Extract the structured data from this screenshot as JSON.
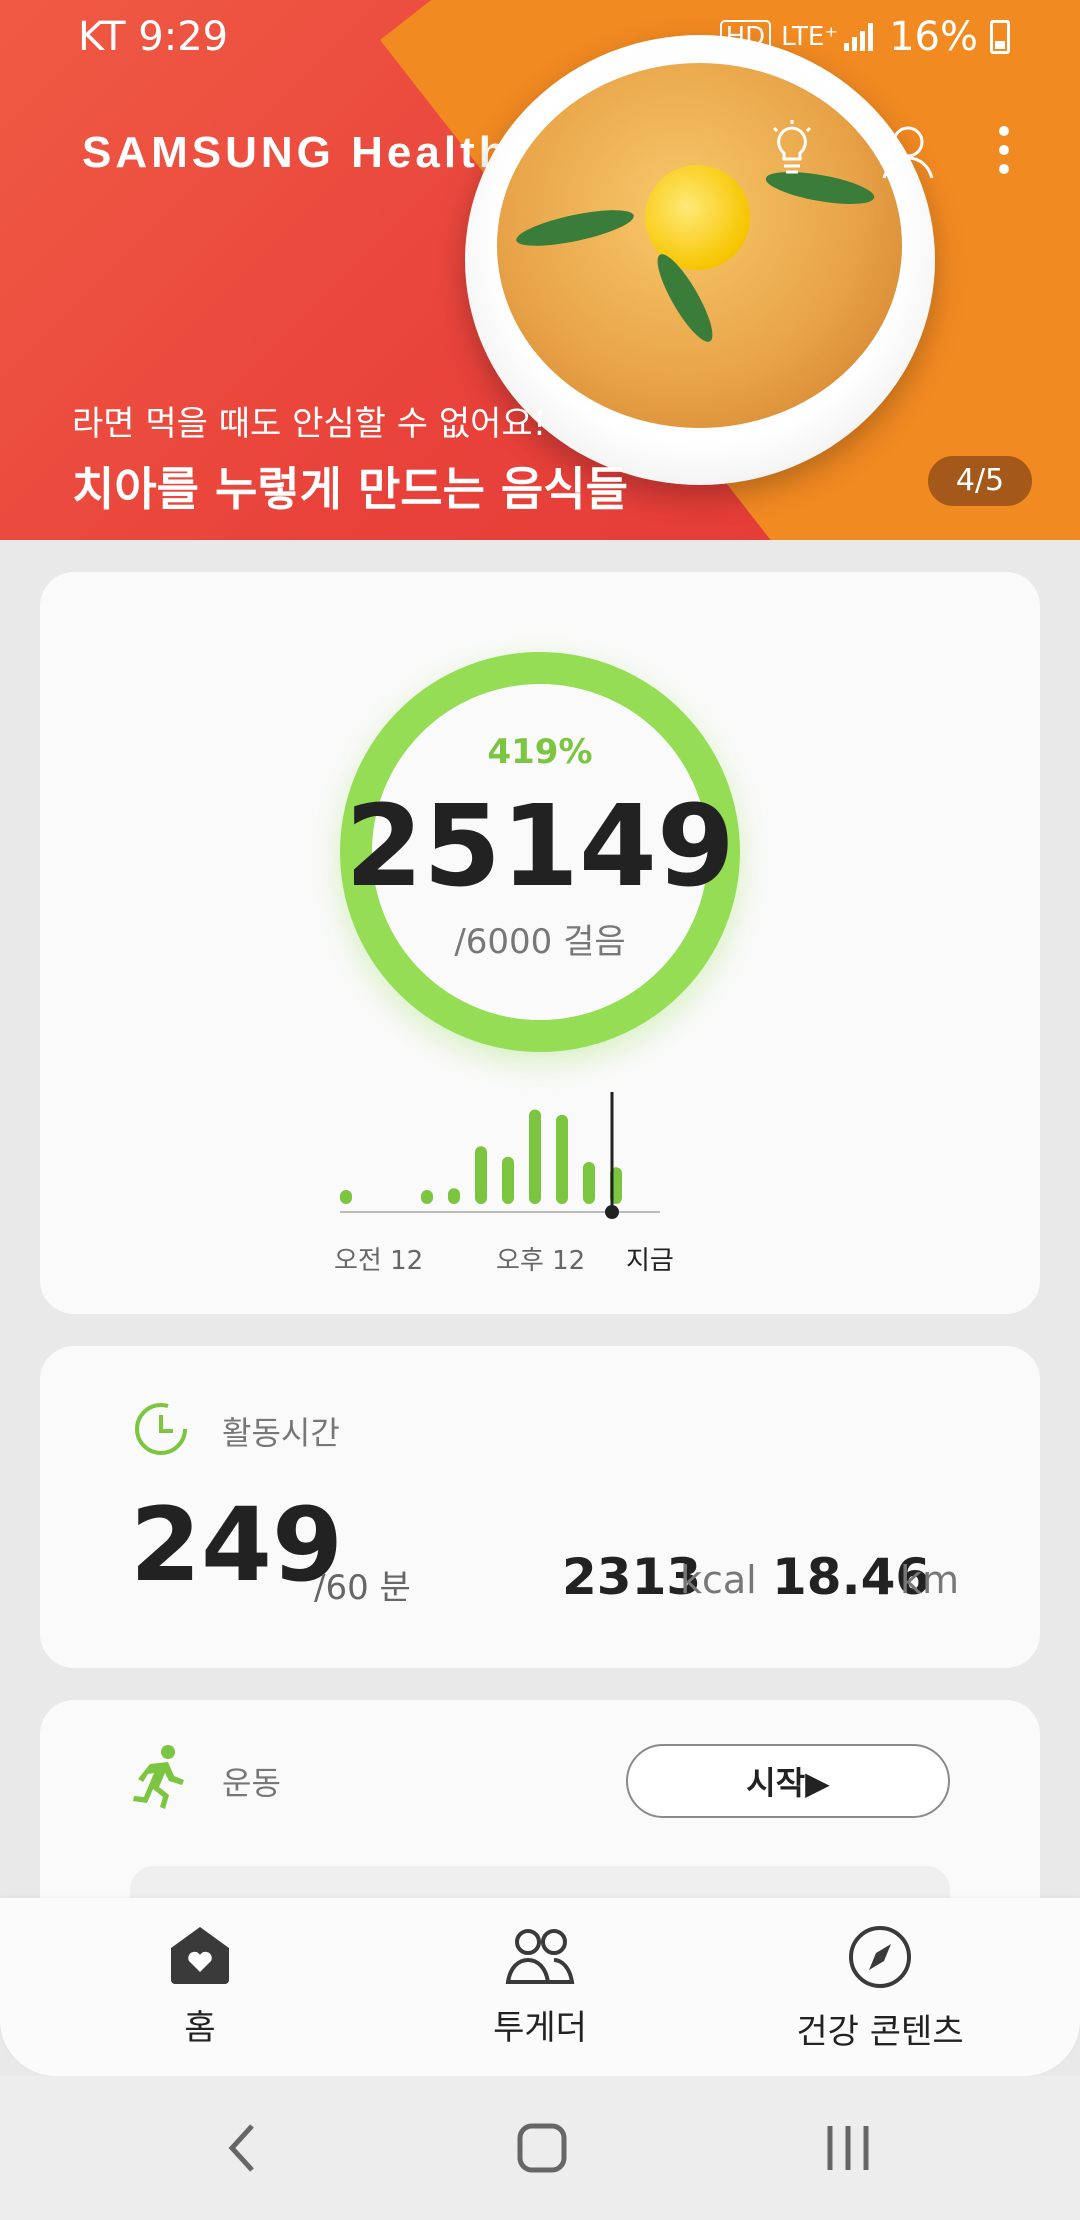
{
  "status_bar": {
    "carrier_time": "KT 9:29",
    "signal_badge": "HD",
    "network": "LTE⁺",
    "battery": "16%"
  },
  "header": {
    "logo": "SAMSUNG Health",
    "icons": [
      "lightbulb-icon",
      "profile-icon",
      "more-options-icon"
    ],
    "banner_subtitle": "라면 먹을 때도 안심할 수 없어요!",
    "banner_title": "치아를 누렇게 만드는 음식들",
    "pager": "4/5"
  },
  "steps": {
    "percent": "419%",
    "count": "25149",
    "goal": "/6000 걸음",
    "ring_color": "#95dd55",
    "bars": [
      0.1,
      0,
      0,
      0.1,
      0.15,
      0.55,
      0.45,
      0.9,
      0.85,
      0.4,
      0.35
    ],
    "labels": {
      "start": "오전 12",
      "mid": "오후 12",
      "now": "지금"
    }
  },
  "activity": {
    "title": "활동시간",
    "minutes": "249",
    "goal": "/60 분",
    "kcal_value": "2313",
    "kcal_unit": "kcal",
    "distance_value": "18.46",
    "distance_unit": "km"
  },
  "exercise": {
    "title": "운동",
    "start_label": "시작▶"
  },
  "bottom_nav": [
    {
      "label": "홈",
      "icon": "home-heart-icon"
    },
    {
      "label": "투게더",
      "icon": "people-icon"
    },
    {
      "label": "건강 콘텐츠",
      "icon": "compass-icon"
    }
  ],
  "system_nav": [
    "back-icon",
    "home-icon",
    "recents-icon"
  ]
}
